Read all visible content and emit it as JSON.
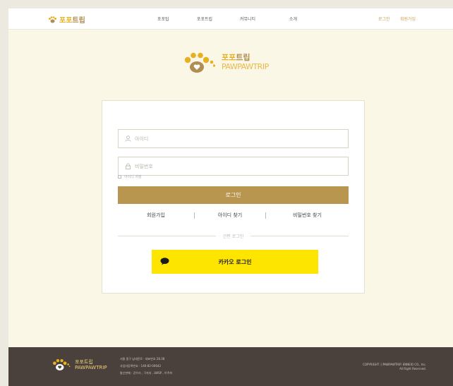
{
  "header": {
    "logo_text_po": "포포",
    "logo_text_trip": "트립",
    "nav": [
      "포포팁",
      "포포트립",
      "커뮤니티",
      "소개"
    ],
    "login": "로그인",
    "signup": "회원가입"
  },
  "brand": {
    "ko_po": "포포",
    "ko_trip": "트립",
    "en": "PAWPAWTRIP"
  },
  "form": {
    "id_placeholder": "아이디",
    "pw_placeholder": "비밀번호",
    "remember_label": "아이디 저장",
    "login_button": "로그인",
    "links": [
      "회원가입",
      "아이디 찾기",
      "비밀번호 찾기"
    ],
    "easy_login": "간편 로그인",
    "kakao_button": "카카오 로그인"
  },
  "footer": {
    "logo_ko": "포포트립",
    "logo_en": "PAWPAWTRIP",
    "info": [
      "서울 중구 남대문로 · 대표번호 28.38",
      "사업자등록번호 : 140-82-00642",
      "통신판매 : 강우리 , 구자유 , LWSP , 이주희"
    ],
    "copyright_1": "COPYRIGHT ⓒPAWPAWTRIP. ENNEIO CO., Inc.",
    "copyright_2": "All Right Reserved."
  },
  "colors": {
    "accent": "#b8964f",
    "logo_yellow": "#e8b020",
    "kakao": "#fee500",
    "footer_bg": "#4a403c",
    "page_bg": "#fbf7e7"
  }
}
